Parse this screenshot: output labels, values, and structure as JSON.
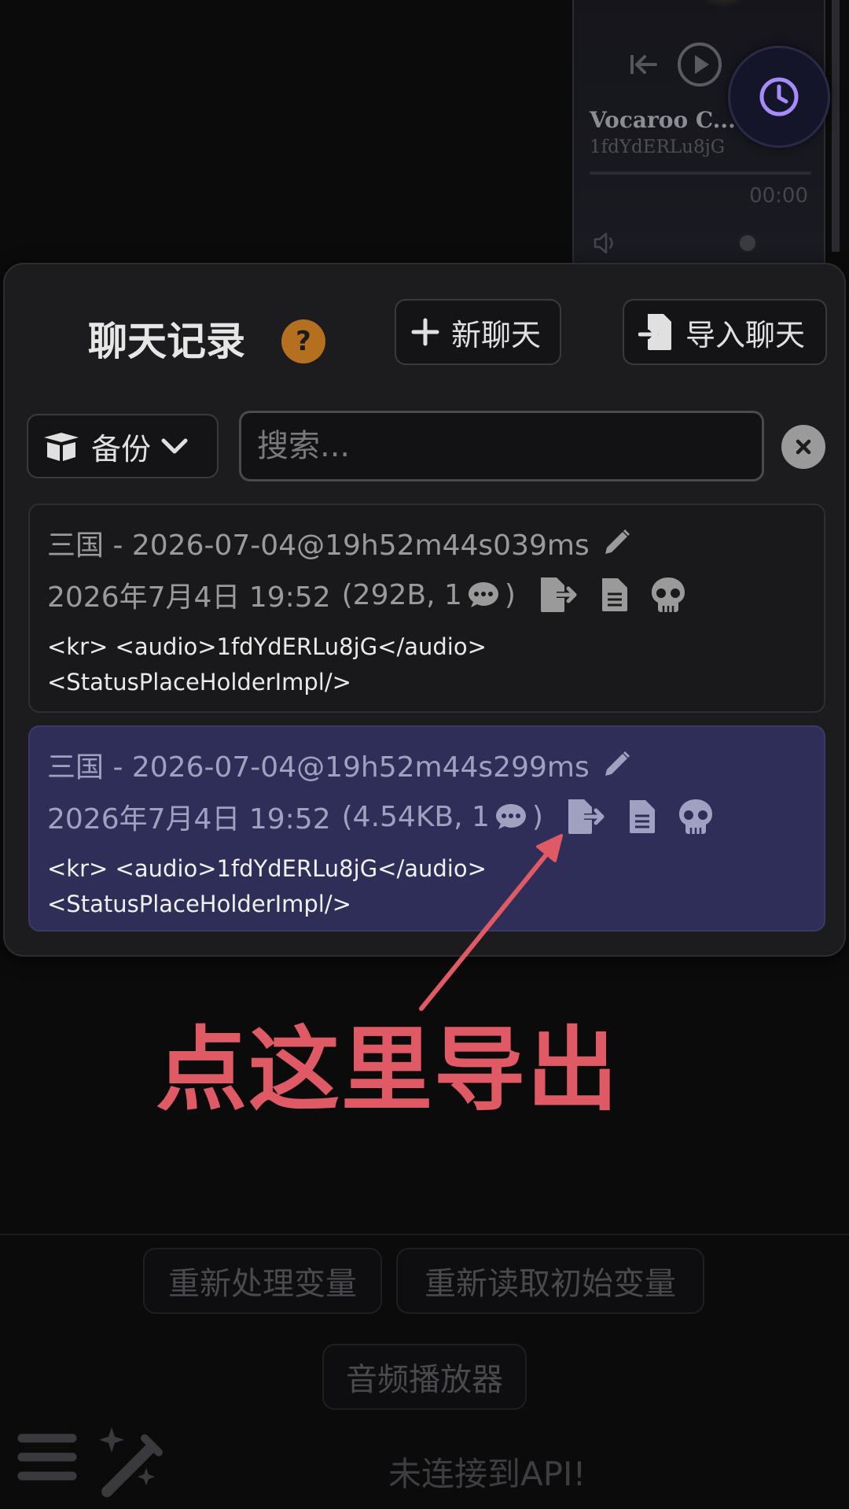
{
  "player": {
    "title": "Vocaroo C...",
    "subtitle": "1fdYdERLu8jG",
    "time": "00:00"
  },
  "panel": {
    "title": "聊天记录",
    "help_label": "?",
    "new_chat_label": "新聊天",
    "import_chat_label": "导入聊天",
    "backup_label": "备份",
    "search_placeholder": "搜索..."
  },
  "entries": [
    {
      "name": "三国 - 2026-07-04@19h52m44s039ms",
      "date": "2026年7月4日 19:52",
      "size": "(292B, 1",
      "size_close": ")",
      "preview_line1": "<kr> <audio>1fdYdERLu8jG</audio>",
      "preview_line2": "<StatusPlaceHolderImpl/>"
    },
    {
      "name": "三国 - 2026-07-04@19h52m44s299ms",
      "date": "2026年7月4日 19:52",
      "size": "(4.54KB, 1",
      "size_close": ")",
      "preview_line1": "<kr> <audio>1fdYdERLu8jG</audio>",
      "preview_line2": "<StatusPlaceHolderImpl/>"
    }
  ],
  "annotation": {
    "text": "点这里导出",
    "color": "#e05a66"
  },
  "bottom": {
    "reprocess_label": "重新处理变量",
    "reload_label": "重新读取初始变量",
    "audio_player_label": "音频播放器",
    "status": "未连接到API!"
  },
  "colors": {
    "selected_entry": "#2e2e58",
    "help_badge": "#b46f1f",
    "clock_accent": "#a78bfa"
  }
}
